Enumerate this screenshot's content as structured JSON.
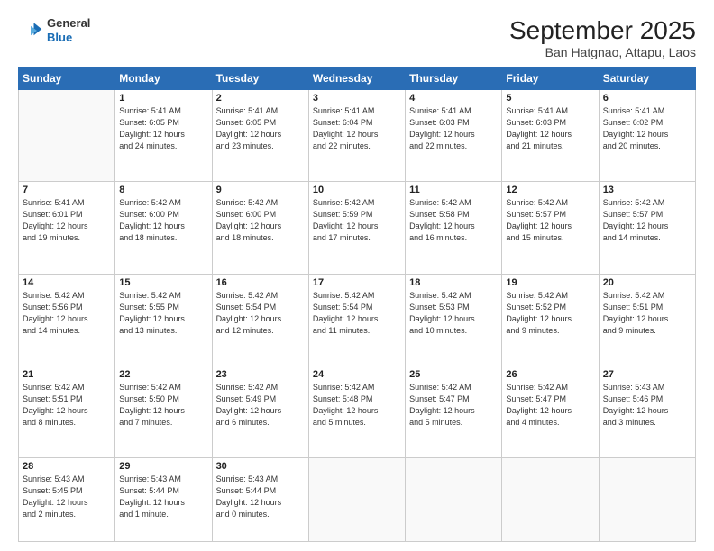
{
  "header": {
    "logo_general": "General",
    "logo_blue": "Blue",
    "month_title": "September 2025",
    "subtitle": "Ban Hatgnao, Attapu, Laos"
  },
  "weekdays": [
    "Sunday",
    "Monday",
    "Tuesday",
    "Wednesday",
    "Thursday",
    "Friday",
    "Saturday"
  ],
  "weeks": [
    [
      {
        "day": "",
        "info": ""
      },
      {
        "day": "1",
        "info": "Sunrise: 5:41 AM\nSunset: 6:05 PM\nDaylight: 12 hours\nand 24 minutes."
      },
      {
        "day": "2",
        "info": "Sunrise: 5:41 AM\nSunset: 6:05 PM\nDaylight: 12 hours\nand 23 minutes."
      },
      {
        "day": "3",
        "info": "Sunrise: 5:41 AM\nSunset: 6:04 PM\nDaylight: 12 hours\nand 22 minutes."
      },
      {
        "day": "4",
        "info": "Sunrise: 5:41 AM\nSunset: 6:03 PM\nDaylight: 12 hours\nand 22 minutes."
      },
      {
        "day": "5",
        "info": "Sunrise: 5:41 AM\nSunset: 6:03 PM\nDaylight: 12 hours\nand 21 minutes."
      },
      {
        "day": "6",
        "info": "Sunrise: 5:41 AM\nSunset: 6:02 PM\nDaylight: 12 hours\nand 20 minutes."
      }
    ],
    [
      {
        "day": "7",
        "info": "Sunrise: 5:41 AM\nSunset: 6:01 PM\nDaylight: 12 hours\nand 19 minutes."
      },
      {
        "day": "8",
        "info": "Sunrise: 5:42 AM\nSunset: 6:00 PM\nDaylight: 12 hours\nand 18 minutes."
      },
      {
        "day": "9",
        "info": "Sunrise: 5:42 AM\nSunset: 6:00 PM\nDaylight: 12 hours\nand 18 minutes."
      },
      {
        "day": "10",
        "info": "Sunrise: 5:42 AM\nSunset: 5:59 PM\nDaylight: 12 hours\nand 17 minutes."
      },
      {
        "day": "11",
        "info": "Sunrise: 5:42 AM\nSunset: 5:58 PM\nDaylight: 12 hours\nand 16 minutes."
      },
      {
        "day": "12",
        "info": "Sunrise: 5:42 AM\nSunset: 5:57 PM\nDaylight: 12 hours\nand 15 minutes."
      },
      {
        "day": "13",
        "info": "Sunrise: 5:42 AM\nSunset: 5:57 PM\nDaylight: 12 hours\nand 14 minutes."
      }
    ],
    [
      {
        "day": "14",
        "info": "Sunrise: 5:42 AM\nSunset: 5:56 PM\nDaylight: 12 hours\nand 14 minutes."
      },
      {
        "day": "15",
        "info": "Sunrise: 5:42 AM\nSunset: 5:55 PM\nDaylight: 12 hours\nand 13 minutes."
      },
      {
        "day": "16",
        "info": "Sunrise: 5:42 AM\nSunset: 5:54 PM\nDaylight: 12 hours\nand 12 minutes."
      },
      {
        "day": "17",
        "info": "Sunrise: 5:42 AM\nSunset: 5:54 PM\nDaylight: 12 hours\nand 11 minutes."
      },
      {
        "day": "18",
        "info": "Sunrise: 5:42 AM\nSunset: 5:53 PM\nDaylight: 12 hours\nand 10 minutes."
      },
      {
        "day": "19",
        "info": "Sunrise: 5:42 AM\nSunset: 5:52 PM\nDaylight: 12 hours\nand 9 minutes."
      },
      {
        "day": "20",
        "info": "Sunrise: 5:42 AM\nSunset: 5:51 PM\nDaylight: 12 hours\nand 9 minutes."
      }
    ],
    [
      {
        "day": "21",
        "info": "Sunrise: 5:42 AM\nSunset: 5:51 PM\nDaylight: 12 hours\nand 8 minutes."
      },
      {
        "day": "22",
        "info": "Sunrise: 5:42 AM\nSunset: 5:50 PM\nDaylight: 12 hours\nand 7 minutes."
      },
      {
        "day": "23",
        "info": "Sunrise: 5:42 AM\nSunset: 5:49 PM\nDaylight: 12 hours\nand 6 minutes."
      },
      {
        "day": "24",
        "info": "Sunrise: 5:42 AM\nSunset: 5:48 PM\nDaylight: 12 hours\nand 5 minutes."
      },
      {
        "day": "25",
        "info": "Sunrise: 5:42 AM\nSunset: 5:47 PM\nDaylight: 12 hours\nand 5 minutes."
      },
      {
        "day": "26",
        "info": "Sunrise: 5:42 AM\nSunset: 5:47 PM\nDaylight: 12 hours\nand 4 minutes."
      },
      {
        "day": "27",
        "info": "Sunrise: 5:43 AM\nSunset: 5:46 PM\nDaylight: 12 hours\nand 3 minutes."
      }
    ],
    [
      {
        "day": "28",
        "info": "Sunrise: 5:43 AM\nSunset: 5:45 PM\nDaylight: 12 hours\nand 2 minutes."
      },
      {
        "day": "29",
        "info": "Sunrise: 5:43 AM\nSunset: 5:44 PM\nDaylight: 12 hours\nand 1 minute."
      },
      {
        "day": "30",
        "info": "Sunrise: 5:43 AM\nSunset: 5:44 PM\nDaylight: 12 hours\nand 0 minutes."
      },
      {
        "day": "",
        "info": ""
      },
      {
        "day": "",
        "info": ""
      },
      {
        "day": "",
        "info": ""
      },
      {
        "day": "",
        "info": ""
      }
    ]
  ]
}
